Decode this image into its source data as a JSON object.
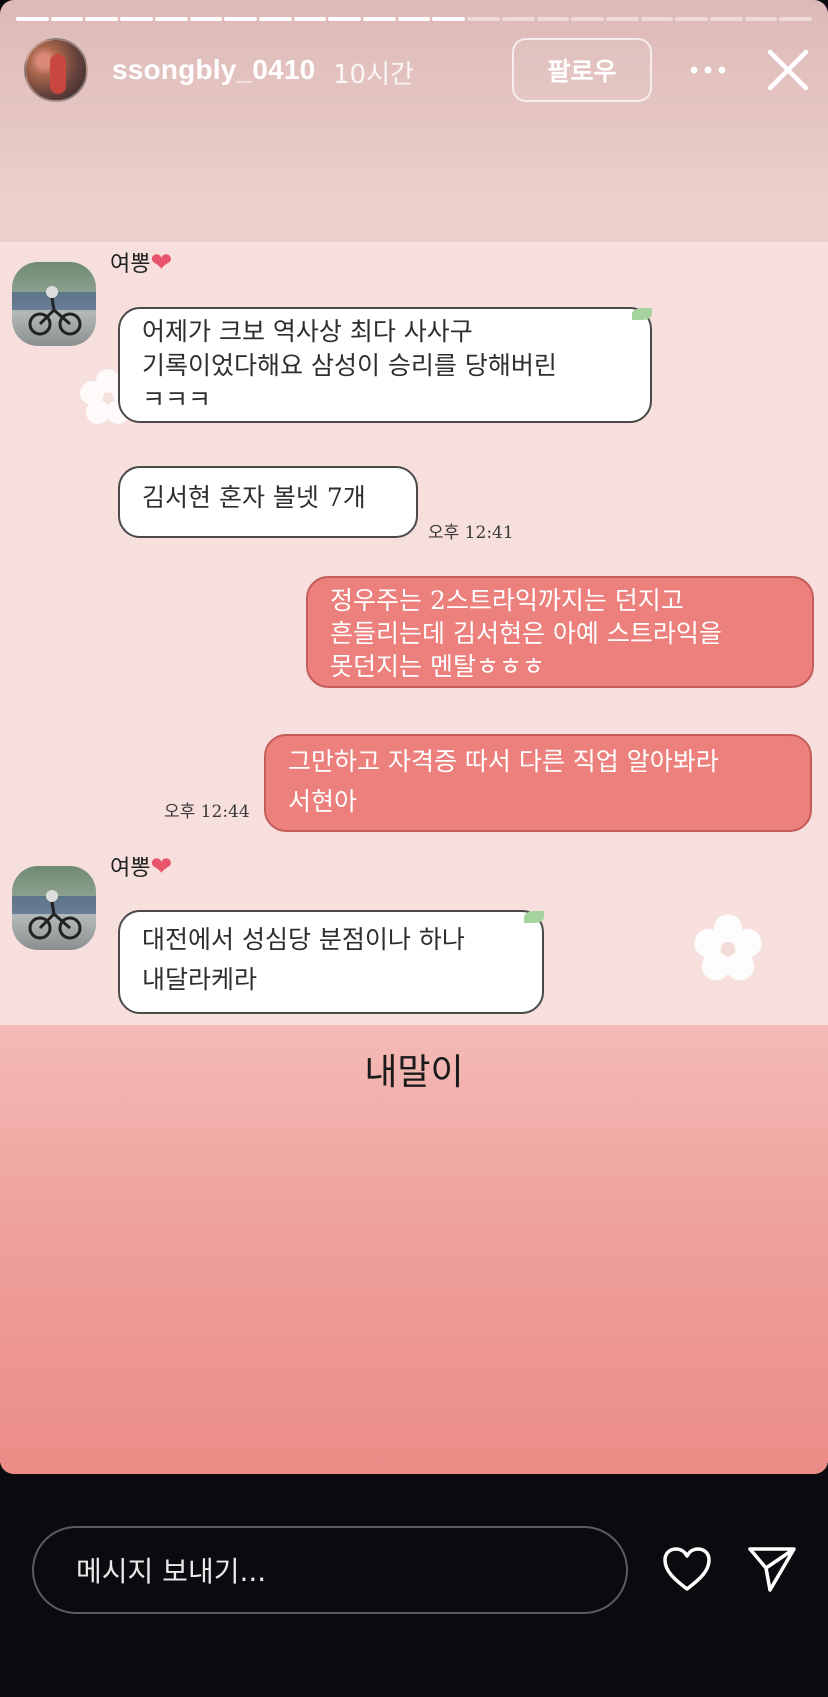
{
  "header": {
    "username": "ssongbly_0410",
    "time_ago": "10시간",
    "follow_label": "팔로우",
    "more_icon": "more-dots-icon",
    "close_icon": "close-icon",
    "progress": {
      "segments": 23,
      "current": 13
    }
  },
  "chat": {
    "friend_name": "여뽕",
    "messages": [
      {
        "line1": "어제가 크보 역사상 최다 사사구",
        "line2": "기록이었다해요 삼성이 승리를 당해버린",
        "line3": "ㅋㅋㅋ"
      },
      {
        "text": "김서현 혼자 볼넷 7개"
      },
      {
        "time": "오후 12:41"
      },
      {
        "line1": "정우주는 2스트라익까지는 던지고",
        "line2": "흔들리는데 김서현은 아예 스트라익을",
        "line3": "못던지는 멘탈ㅎㅎㅎ"
      },
      {
        "line1": "그만하고 자격증 따서 다른 직업 알아봐라",
        "line2": "서현아"
      },
      {
        "time": "오후 12:44"
      },
      {
        "line1": "대전에서 성심당 분점이나 하나",
        "line2": "내달라케라"
      }
    ]
  },
  "caption": "내말이",
  "bottom_bar": {
    "message_placeholder": "메시지 보내기...",
    "like_icon": "heart-icon",
    "share_icon": "send-icon"
  }
}
